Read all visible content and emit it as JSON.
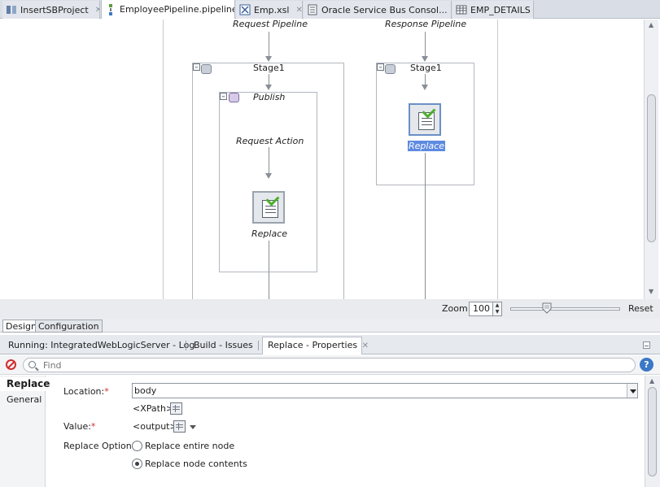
{
  "tabs": [
    {
      "label": "InsertSBProject",
      "icon": "project-icon",
      "active": false
    },
    {
      "label": "EmployeePipeline.pipeline",
      "icon": "pipeline-icon",
      "active": true
    },
    {
      "label": "Emp.xsl",
      "icon": "xsl-icon",
      "active": false
    },
    {
      "label": "Oracle Service Bus Consol...",
      "icon": "document-icon",
      "active": false
    },
    {
      "label": "EMP_DETAILS",
      "icon": "table-icon",
      "active": false
    }
  ],
  "canvas": {
    "request_pipeline": "Request Pipeline",
    "response_pipeline": "Response Pipeline",
    "req_stage": "Stage1",
    "resp_stage": "Stage1",
    "publish": "Publish",
    "request_action": "Request Action",
    "req_replace": "Replace",
    "resp_replace": "Replace"
  },
  "zoom": {
    "label": "Zoom:",
    "value": "100",
    "level_percent": 100,
    "reset": "Reset"
  },
  "view_tabs": {
    "design": "Design",
    "configuration": "Configuration"
  },
  "panel": {
    "tabs": [
      "Running: IntegratedWebLogicServer - Log",
      "Build - Issues",
      "Replace - Properties"
    ],
    "find_placeholder": "Find",
    "help": "?",
    "nav": {
      "replace": "Replace",
      "general": "General"
    },
    "location_label": "Location:",
    "location_value": "body",
    "xpath": "<XPath>",
    "value_label": "Value:",
    "value_value": "<output>",
    "replace_option_label": "Replace Option:",
    "option_entire": "Replace entire node",
    "option_contents": "Replace node contents",
    "required_mark": "*"
  }
}
